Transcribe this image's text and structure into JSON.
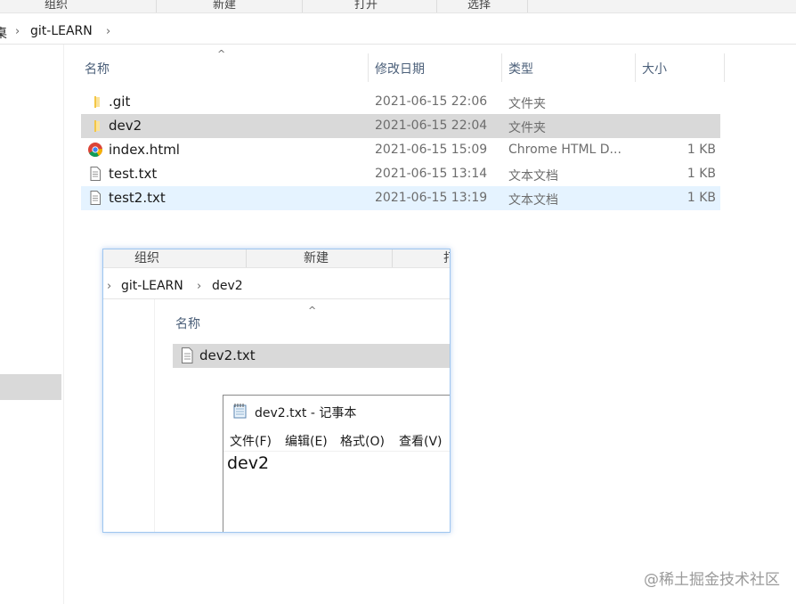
{
  "explorer": {
    "ribbon": [
      "组织",
      "新建",
      "打开",
      "选择"
    ],
    "breadcrumb": {
      "prev": "桌",
      "current": "git-LEARN"
    },
    "columns": {
      "name": "名称",
      "date": "修改日期",
      "type": "类型",
      "size": "大小"
    },
    "files": [
      {
        "name": ".git",
        "date": "2021-06-15 22:06",
        "type": "文件夹",
        "size": "",
        "icon": "folder-icon"
      },
      {
        "name": "dev2",
        "date": "2021-06-15 22:04",
        "type": "文件夹",
        "size": "",
        "icon": "folder-icon"
      },
      {
        "name": "index.html",
        "date": "2021-06-15 15:09",
        "type": "Chrome HTML D...",
        "size": "1 KB",
        "icon": "chrome-icon"
      },
      {
        "name": "test.txt",
        "date": "2021-06-15 13:14",
        "type": "文本文档",
        "size": "1 KB",
        "icon": "text-file-icon"
      },
      {
        "name": "test2.txt",
        "date": "2021-06-15 13:19",
        "type": "文本文档",
        "size": "1 KB",
        "icon": "text-file-icon"
      }
    ]
  },
  "inner_explorer": {
    "ribbon": [
      "组织",
      "新建",
      "打"
    ],
    "breadcrumb": {
      "root": "git-LEARN",
      "current": "dev2"
    },
    "column_name": "名称",
    "file": "dev2.txt"
  },
  "notepad": {
    "title": "dev2.txt - 记事本",
    "menu": [
      "文件(F)",
      "编辑(E)",
      "格式(O)",
      "查看(V)"
    ],
    "content": "dev2"
  },
  "watermark": "@稀土掘金技术社区",
  "colors": {
    "selected_row": "#d9d9d9",
    "hover_row": "#e5f3ff",
    "folder": "#f3c646",
    "column_header": "#4c607a"
  }
}
